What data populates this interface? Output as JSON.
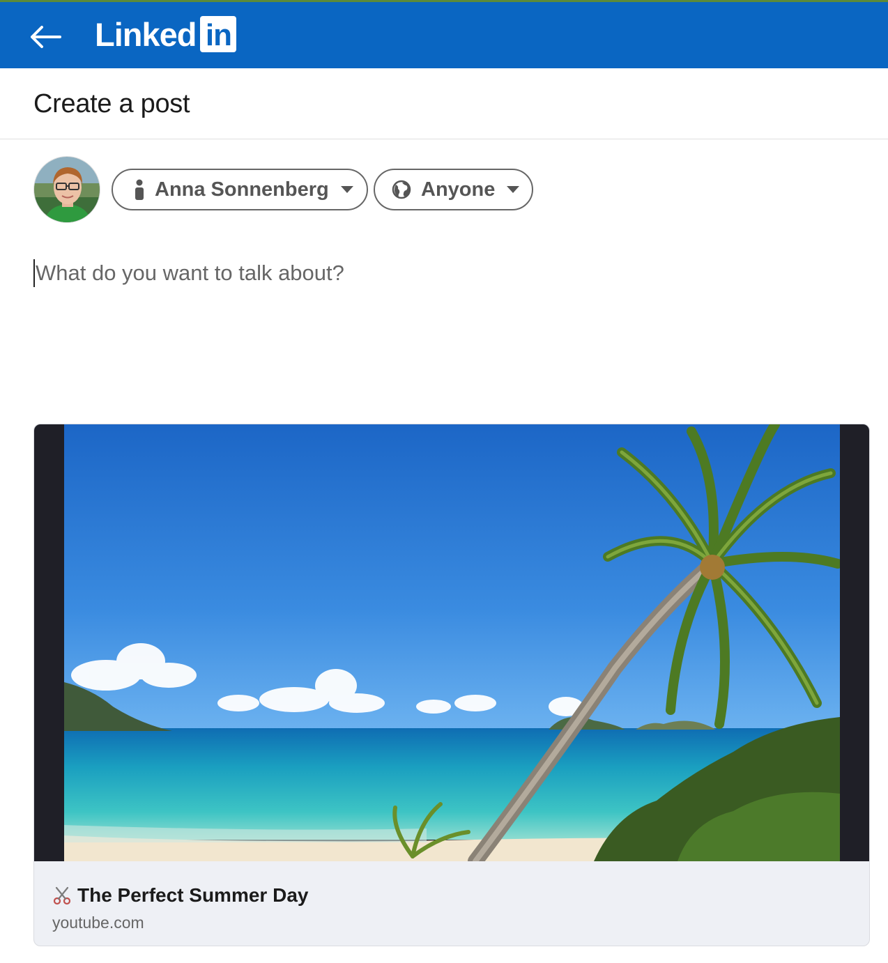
{
  "topbar": {
    "back_icon": "arrow-left-icon",
    "logo_word": "Linked",
    "logo_badge": "in",
    "brand_color": "#0a66c2"
  },
  "header": {
    "title": "Create a post"
  },
  "composer": {
    "author": {
      "name": "Anna Sonnenberg",
      "icon": "person-icon"
    },
    "visibility": {
      "label": "Anyone",
      "icon": "globe-icon"
    },
    "placeholder": "What do you want to talk about?"
  },
  "link_preview": {
    "title_icon": "scissors-icon",
    "title": "The Perfect Summer Day",
    "source": "youtube.com"
  }
}
